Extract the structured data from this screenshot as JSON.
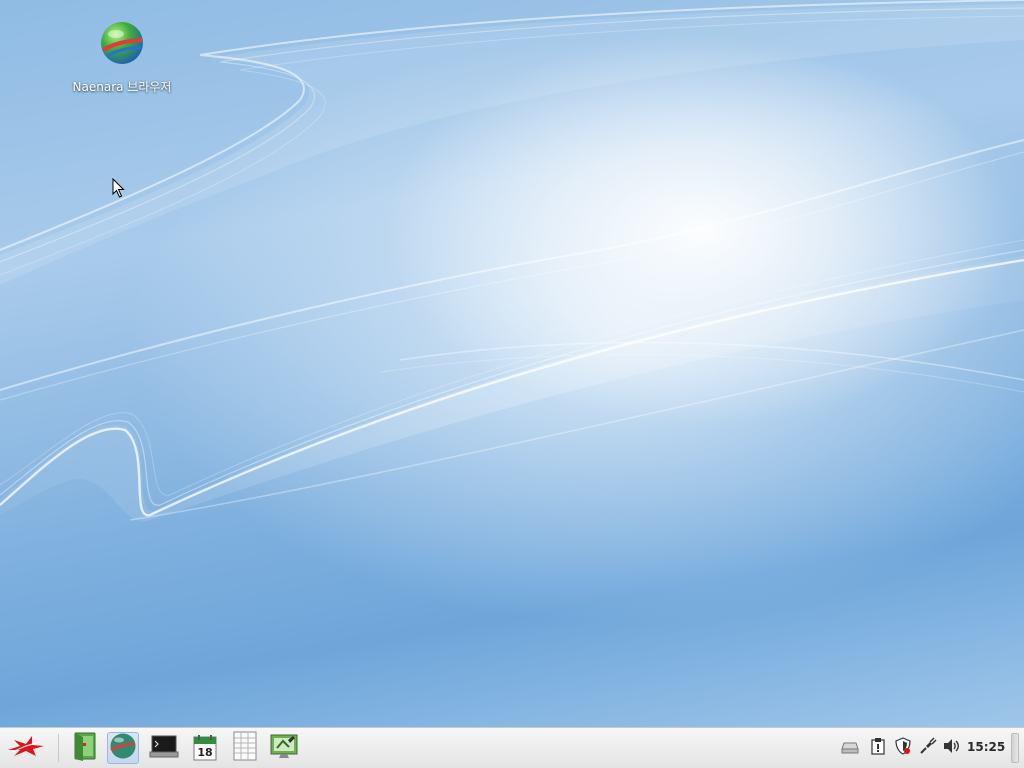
{
  "desktop": {
    "icons": [
      {
        "label": "Naenara 브라우저",
        "icon": "naenara-browser-globe-icon"
      }
    ]
  },
  "taskbar": {
    "start": {
      "icon": "red-star-menu-icon"
    },
    "launchers": [
      {
        "icon": "file-manager-icon"
      },
      {
        "icon": "naenara-browser-globe-icon",
        "active": true
      },
      {
        "icon": "terminal-icon"
      },
      {
        "icon": "calendar-icon",
        "day": "18"
      },
      {
        "icon": "spreadsheet-icon"
      },
      {
        "icon": "system-settings-icon"
      }
    ],
    "tray": [
      {
        "icon": "removable-drive-icon"
      },
      {
        "icon": "clipboard-icon"
      },
      {
        "icon": "security-shield-icon"
      },
      {
        "icon": "network-connection-icon"
      },
      {
        "icon": "volume-icon"
      }
    ],
    "clock": "15:25"
  },
  "colors": {
    "desktop_base": "#8fbbe4",
    "taskbar_bg": "#ececec",
    "start_red": "#d9161a",
    "active_launcher_bg": "#c4d8ee"
  }
}
